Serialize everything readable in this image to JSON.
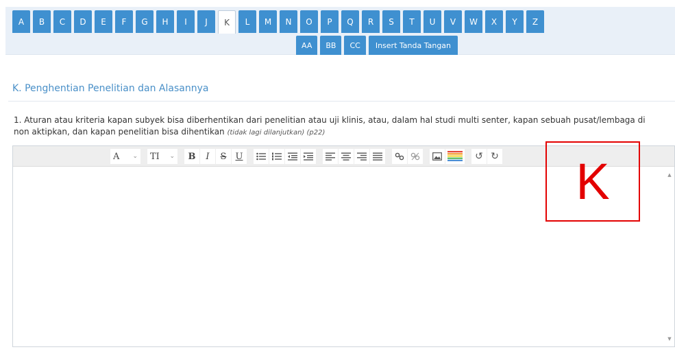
{
  "tabs": {
    "letters": [
      "A",
      "B",
      "C",
      "D",
      "E",
      "F",
      "G",
      "H",
      "I",
      "J",
      "K",
      "L",
      "M",
      "N",
      "O",
      "P",
      "Q",
      "R",
      "S",
      "T",
      "U",
      "V",
      "W",
      "X",
      "Y",
      "Z"
    ],
    "active": "K",
    "sub": [
      "AA",
      "BB",
      "CC",
      "Insert Tanda Tangan"
    ]
  },
  "section": {
    "title": "K. Penghentian Penelitian dan Alasannya"
  },
  "question": {
    "text": "1. Aturan atau kriteria kapan subyek bisa diberhentikan dari penelitian atau uji klinis, atau, dalam hal studi multi senter, kapan sebuah pusat/lembaga di non aktipkan, dan kapan penelitian bisa dihentikan",
    "note": "(tidak lagi dilanjutkan) (p22)"
  },
  "toolbar": {
    "font_label": "A",
    "size_label": "TI",
    "bold": "B",
    "italic": "I",
    "strike": "S",
    "underline": "U",
    "icons": [
      "font-family-icon",
      "font-size-icon",
      "bold-icon",
      "italic-icon",
      "strikethrough-icon",
      "underline-icon",
      "bullet-list-icon",
      "numbered-list-icon",
      "outdent-icon",
      "indent-icon",
      "align-left-icon",
      "align-center-icon",
      "align-right-icon",
      "justify-icon",
      "link-icon",
      "unlink-icon",
      "image-icon",
      "color-icon",
      "undo-icon",
      "redo-icon"
    ]
  },
  "overlay": {
    "letter": "K",
    "color": "#e30000"
  },
  "colors": {
    "tab": "#3f90d0",
    "accent": "#4a90c8"
  }
}
